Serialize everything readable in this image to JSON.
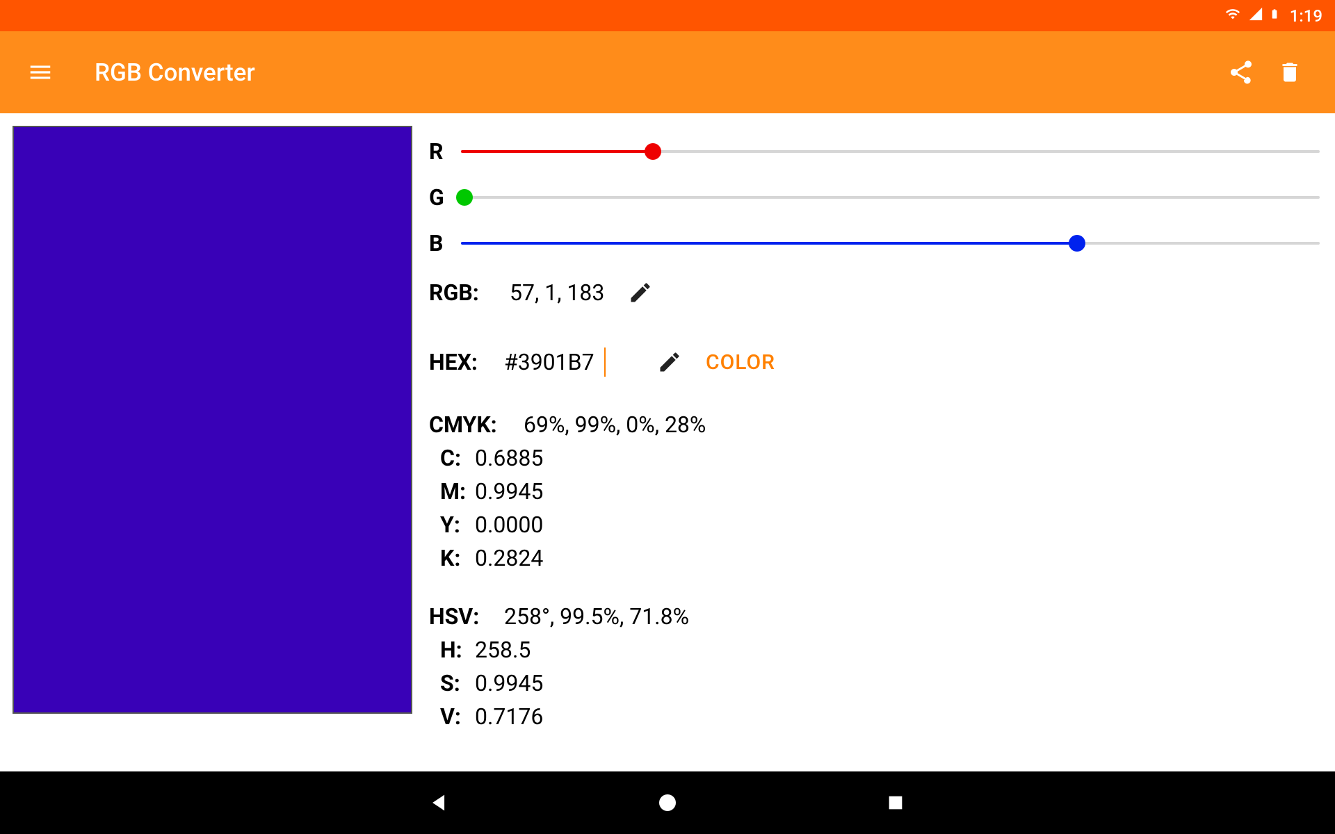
{
  "status": {
    "time": "1:19"
  },
  "app": {
    "title": "RGB Converter"
  },
  "sliders": {
    "r": {
      "label": "R",
      "value": 57,
      "max": 255
    },
    "g": {
      "label": "G",
      "value": 1,
      "max": 255
    },
    "b": {
      "label": "B",
      "value": 183,
      "max": 255
    }
  },
  "swatch_color": "#3901B7",
  "rgb": {
    "label": "RGB:",
    "value": "57, 1, 183"
  },
  "hex": {
    "label": "HEX:",
    "value": "#3901B7",
    "color_button": "COLOR"
  },
  "cmyk": {
    "label": "CMYK:",
    "summary": "69%, 99%, 0%, 28%",
    "c": {
      "label": "C:",
      "value": "0.6885"
    },
    "m": {
      "label": "M:",
      "value": "0.9945"
    },
    "y": {
      "label": "Y:",
      "value": "0.0000"
    },
    "k": {
      "label": "K:",
      "value": "0.2824"
    }
  },
  "hsv": {
    "label": "HSV:",
    "summary": "258°, 99.5%, 71.8%",
    "h": {
      "label": "H:",
      "value": "258.5"
    },
    "s": {
      "label": "S:",
      "value": "0.9945"
    },
    "v": {
      "label": "V:",
      "value": "0.7176"
    }
  }
}
